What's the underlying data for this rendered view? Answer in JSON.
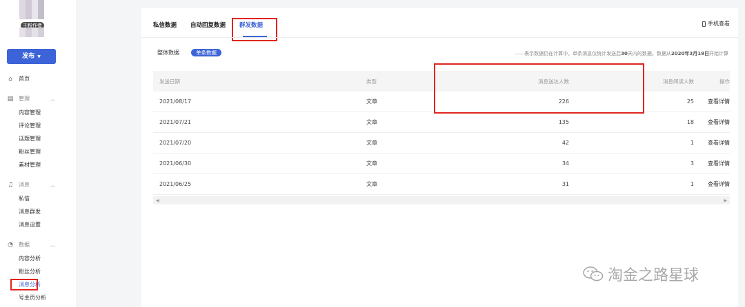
{
  "sidebar": {
    "author_badge": "千粉作者",
    "publish_label": "发布",
    "home": "首页",
    "groups": [
      {
        "label": "管理",
        "items": [
          "内容管理",
          "评论管理",
          "话题管理",
          "粉丝管理",
          "素材管理"
        ]
      },
      {
        "label": "消息",
        "items": [
          "私信",
          "消息群发",
          "消息设置"
        ]
      },
      {
        "label": "数据",
        "items": [
          "内容分析",
          "粉丝分析",
          "消息分析",
          "号主页分析"
        ]
      }
    ]
  },
  "tabs": [
    "私信数据",
    "自动回复数据",
    "群发数据"
  ],
  "active_tab": "群发数据",
  "mobile_view": "手机查看",
  "subtabs": [
    "整体数据",
    "单条数据"
  ],
  "note": {
    "prefix": "——表示数据仍在计算中。单条消息仅统计发送后",
    "days": "30",
    "mid": "天内的数据。数据从",
    "date": "2020年3月19日",
    "suffix": "开始计算"
  },
  "table": {
    "columns": [
      "发送日期",
      "类型",
      "消息送达人数",
      "消息阅读人数",
      "操作"
    ],
    "rows": [
      {
        "date": "2021/08/17",
        "type": "文章",
        "delivered": "226",
        "read": "25",
        "action": "查看详情"
      },
      {
        "date": "2021/07/21",
        "type": "文章",
        "delivered": "135",
        "read": "18",
        "action": "查看详情"
      },
      {
        "date": "2021/07/20",
        "type": "文章",
        "delivered": "42",
        "read": "1",
        "action": "查看详情"
      },
      {
        "date": "2021/06/30",
        "type": "文章",
        "delivered": "34",
        "read": "3",
        "action": "查看详情"
      },
      {
        "date": "2021/06/25",
        "type": "文章",
        "delivered": "31",
        "read": "1",
        "action": "查看详情"
      }
    ]
  },
  "watermark": "淘金之路星球",
  "colors": {
    "accent": "#3c64d8",
    "highlight": "#e0241e"
  }
}
